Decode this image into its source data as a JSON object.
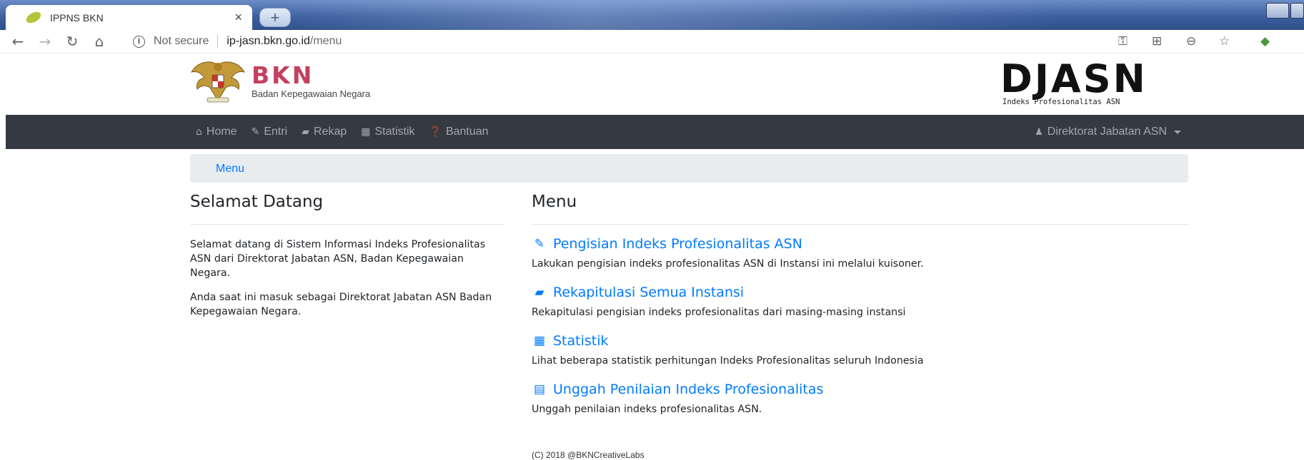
{
  "browser": {
    "tab_title": "IPPNS BKN",
    "tab_close": "×",
    "new_tab": "+",
    "security_label": "Not secure",
    "url_host": "ip-jasn.bkn.go.id",
    "url_path": "/menu"
  },
  "header": {
    "logo_title": "BKN",
    "logo_subtitle": "Badan Kepegawaian Negara",
    "brand_title": "DJASN",
    "brand_subtitle": "Indeks Profesionalitas ASN"
  },
  "navbar": {
    "items": [
      {
        "label": "Home",
        "icon": "home-icon"
      },
      {
        "label": "Entri",
        "icon": "pencil-icon"
      },
      {
        "label": "Rekap",
        "icon": "book-icon"
      },
      {
        "label": "Statistik",
        "icon": "table-icon"
      },
      {
        "label": "Bantuan",
        "icon": "question-icon"
      }
    ],
    "user_label": "Direktorat Jabatan ASN"
  },
  "breadcrumb": {
    "label": "Menu"
  },
  "welcome": {
    "title": "Selamat Datang",
    "paragraph_1": "Selamat datang di Sistem Informasi Indeks Profesionalitas ASN dari Direktorat Jabatan ASN, Badan Kepegawaian Negara.",
    "paragraph_2": "Anda saat ini masuk sebagai Direktorat Jabatan ASN Badan Kepegawaian Negara."
  },
  "menu": {
    "title": "Menu",
    "items": [
      {
        "title": "Pengisian Indeks Profesionalitas ASN",
        "description": "Lakukan pengisian indeks profesionalitas ASN di Instansi ini melalui kuisoner.",
        "icon": "pencil-icon"
      },
      {
        "title": "Rekapitulasi Semua Instansi",
        "description": "Rekapitulasi pengisian indeks profesionalitas dari masing-masing instansi",
        "icon": "book-icon"
      },
      {
        "title": "Statistik",
        "description": "Lihat beberapa statistik perhitungan Indeks Profesionalitas seluruh Indonesia",
        "icon": "calculator-icon"
      },
      {
        "title": "Unggah Penilaian Indeks Profesionalitas",
        "description": "Unggah penilaian indeks profesionalitas ASN.",
        "icon": "table-icon"
      }
    ]
  },
  "footer": {
    "text": "(C) 2018 @BKNCreativeLabs"
  },
  "colors": {
    "navbar": "#343a40",
    "link": "#007bff",
    "bkn": "#c4405f",
    "breadcrumb_bg": "#e9ecef"
  }
}
